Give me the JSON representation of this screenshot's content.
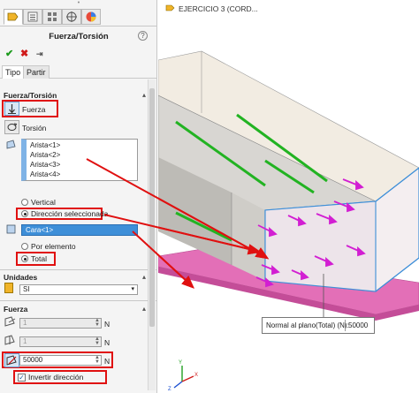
{
  "property_manager": {
    "title": "Fuerza/Torsión",
    "help_icon": "question-icon",
    "accept_icon": "check-icon",
    "cancel_icon": "x-icon",
    "pin_icon": "pushpin-icon",
    "subtabs": [
      "Tipo",
      "Partir"
    ],
    "group_force_torsion": {
      "title": "Fuerza/Torsión",
      "force_label": "Fuerza",
      "torsion_label": "Torsión",
      "selected_edges": [
        "Arista<1>",
        "Arista<2>",
        "Arista<3>",
        "Arista<4>"
      ],
      "direction_options": [
        "Vertical",
        "Dirección seleccionada"
      ],
      "direction_selected": "Dirección seleccionada",
      "direction_face": "Cara<1>",
      "distribution_options": [
        "Por elemento",
        "Total"
      ],
      "distribution_selected": "Total"
    },
    "group_units": {
      "title": "Unidades",
      "value": "SI"
    },
    "group_force": {
      "title": "Fuerza",
      "component_1": "1",
      "component_2": "1",
      "normal_value": "50000",
      "unit": "N",
      "reverse_label": "Invertir dirección",
      "reverse_checked": true
    }
  },
  "viewport": {
    "tree_breadcrumb": "EJERCICIO 3  (CORD...",
    "callout_label": "Normal al plano(Total) (N):",
    "callout_value": "50000"
  },
  "colors": {
    "highlight_red": "#e01010",
    "selection_blue": "#3e8fd8",
    "edge_green": "#22b322",
    "force_arrow_magenta": "#d21ed2",
    "plate_pink": "#e36fb7"
  }
}
